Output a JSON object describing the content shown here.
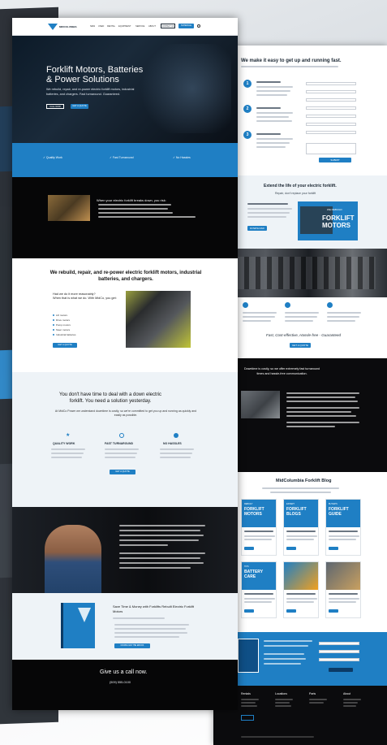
{
  "colors": {
    "accent": "#1f7fc4",
    "dark": "#0b0b0d",
    "light_bg": "#eef3f7"
  },
  "front": {
    "nav": {
      "brand": "MIDCOLUMBIA",
      "items": [
        "NEW",
        "USED",
        "RENTAL",
        "EQUIPMENT",
        "SERVICE",
        "ABOUT"
      ],
      "outline_button": "CONTACT US",
      "blue_button": "SCHEDULE",
      "search_icon": "search-icon"
    },
    "hero": {
      "title": "Forklift Motors, Batteries\n& Power Solutions",
      "subtitle": "We rebuild, repair, and re-power electric forklift motors, industrial batteries, and chargers. Fast turnaround. Guaranteed.",
      "btn1": "CALL NOW",
      "btn2": "GET A QUOTE"
    },
    "features": [
      "✓ Quality Work",
      "✓ Fast Turnaround",
      "✓ No Hassles"
    ],
    "downtime": {
      "title": "When your electric forklift breaks down, you risk:"
    },
    "rebuild": {
      "title": "We rebuild, repair, and re-power electric forklift motors, industrial batteries, and chargers.",
      "lead": "Had we do it more reasonably?\nWhen that is what we do. With MidCo, you get:",
      "list": [
        "Lift motors",
        "Drive motors",
        "Pump motors",
        "Steer motors",
        "Industrial batteries"
      ],
      "button": "GET A QUOTE"
    },
    "yesterday": {
      "title": "You don't have time to deal with a down electric\nforklift. You need a solution yesterday.",
      "sub": "At MidCo Power we understand downtime is costly, so we're committed to get you up and running as quickly and easily as possible.",
      "cols": [
        {
          "title": "QUALITY WORK"
        },
        {
          "title": "FAST TURNAROUND"
        },
        {
          "title": "NO HASSLES"
        }
      ],
      "button": "GET A QUOTE"
    },
    "ebook": {
      "title": "Save Time & Money with Forklifts Rebuilt Electric Forklift Motors",
      "button": "DOWNLOAD THE EBOOK"
    },
    "call": {
      "title": "Give us a call now.",
      "phone": "(509) 555-0100"
    }
  },
  "back": {
    "form_title": "We make it easy to get up and running fast.",
    "steps": [
      "1",
      "2",
      "3"
    ],
    "form_button": "SUBMIT",
    "extend": {
      "title": "Extend the life of your electric forklift.",
      "sub": "Repair, don't replace your forklift",
      "download": "DOWNLOAD",
      "promo_small": "WE REBUILD",
      "promo_big": "FORKLIFT\nMOTORS"
    },
    "tagline": "Fast, Cost-effective, Hassle-free - Guaranteed",
    "tag_button": "GET A QUOTE",
    "downtime": "Downtime is costly, so we offer extremely fast turnaround\ntimes and hassle-free communication.",
    "blog": {
      "title": "MidColumbia Forklift Blog",
      "cards": [
        {
          "big": "FORKLIFT\nMOTORS",
          "small": "REBUILT"
        },
        {
          "big": "FORKLIFT\nBLOGS",
          "small": "EXPERT"
        },
        {
          "big": "FORKLIFT\nGUIDE",
          "small": "BUYER'S"
        },
        {
          "big": "BATTERY\nCARE",
          "small": "TIPS"
        },
        {
          "big": "",
          "small": ""
        },
        {
          "big": "",
          "small": ""
        }
      ]
    },
    "footer_cols": [
      "Rentals",
      "Locations",
      "Parts",
      "About"
    ]
  }
}
